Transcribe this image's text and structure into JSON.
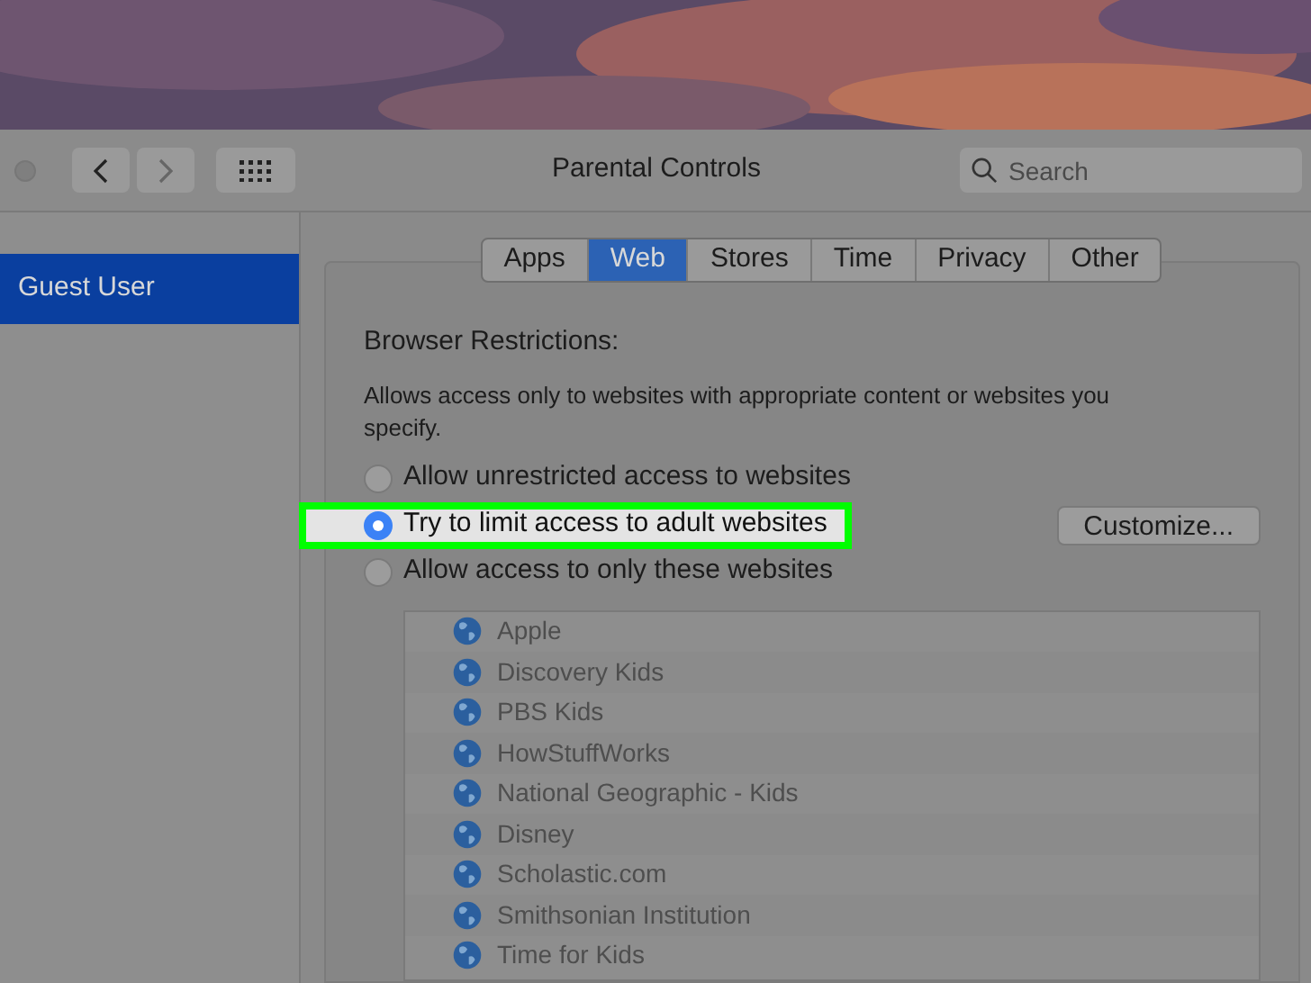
{
  "window": {
    "title": "Parental Controls"
  },
  "search": {
    "placeholder": "Search"
  },
  "sidebar": {
    "items": [
      {
        "label": "Guest User",
        "selected": true
      }
    ]
  },
  "tabs": [
    {
      "label": "Apps",
      "selected": false
    },
    {
      "label": "Web",
      "selected": true
    },
    {
      "label": "Stores",
      "selected": false
    },
    {
      "label": "Time",
      "selected": false
    },
    {
      "label": "Privacy",
      "selected": false
    },
    {
      "label": "Other",
      "selected": false
    }
  ],
  "section_title": "Browser Restrictions:",
  "description": "Allows access only to websites with appropriate content or websites you specify.",
  "options": [
    {
      "label": "Allow unrestricted access to websites",
      "selected": false,
      "highlighted": false
    },
    {
      "label": "Try to limit access to adult websites",
      "selected": true,
      "highlighted": true
    },
    {
      "label": "Allow access to only these websites",
      "selected": false,
      "highlighted": false
    }
  ],
  "customize_button": "Customize...",
  "websites": {
    "disabled": true,
    "items": [
      "Apple",
      "Discovery Kids",
      "PBS Kids",
      "HowStuffWorks",
      "National Geographic - Kids",
      "Disney",
      "Scholastic.com",
      "Smithsonian Institution",
      "Time for Kids"
    ]
  }
}
